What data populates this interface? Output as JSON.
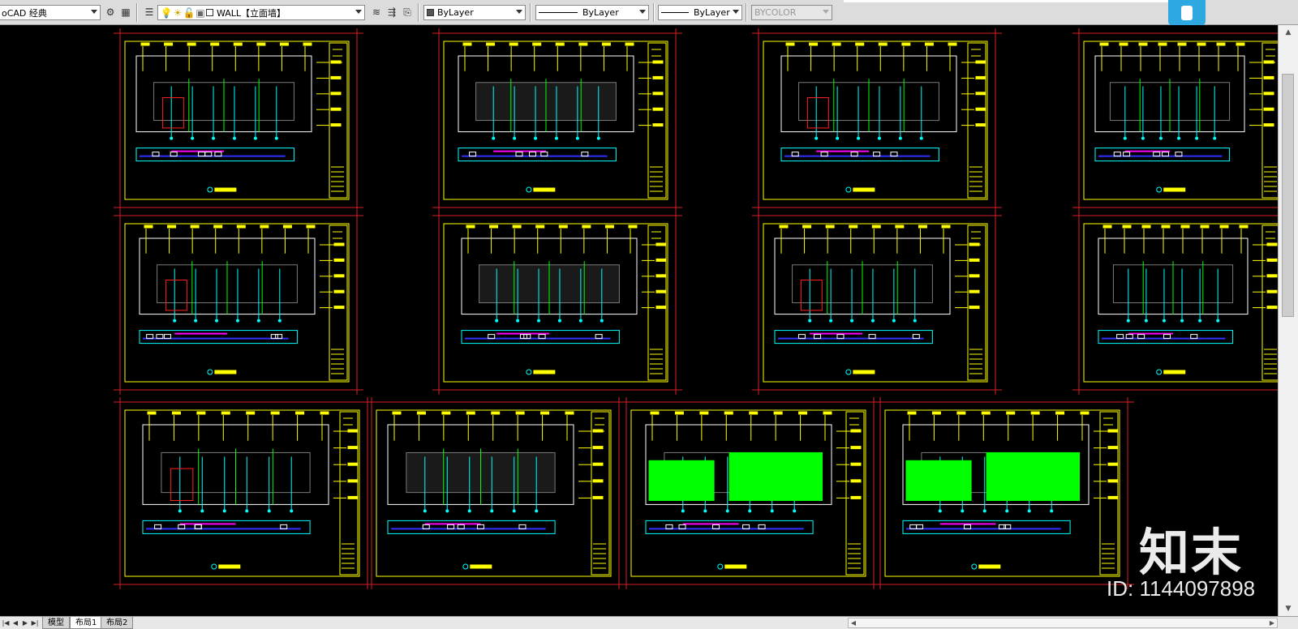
{
  "toolbar": {
    "workspace": "oCAD 经典",
    "layer": "WALL【立面墙】",
    "color": "ByLayer",
    "linetype": "ByLayer",
    "lineweight": "ByLayer",
    "plotstyle": "BYCOLOR"
  },
  "layout_tabs": [
    "模型",
    "布局1",
    "布局2"
  ],
  "active_tab": "布局1",
  "watermark": {
    "brand": "知末",
    "id_text": "ID: 1144097898"
  },
  "colors": {
    "frame": "#d81f26",
    "border": "#ffff00",
    "yellow": "#ffff00",
    "cyan": "#00ffff",
    "green": "#00ff00",
    "blue": "#3030ff",
    "magenta": "#ff00ff",
    "white": "#ffffff",
    "grey": "#7a7a7a",
    "red": "#ff2020",
    "background": "#000000"
  },
  "icons": [
    "gear-icon",
    "bulb-icon",
    "sun-icon",
    "lock-icon",
    "layer-icon",
    "match-icon",
    "dropdown-icon"
  ]
}
